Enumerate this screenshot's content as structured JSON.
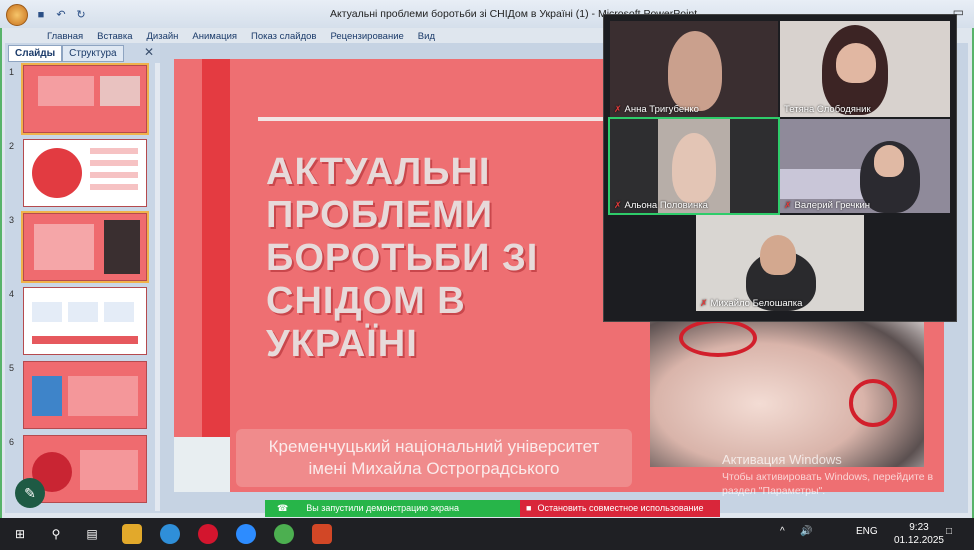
{
  "window": {
    "title": "Актуальні проблеми боротьби зі СНІДом в Україні (1) - Microsoft PowerPoint",
    "ribbon_tabs": [
      "Главная",
      "Вставка",
      "Дизайн",
      "Анимация",
      "Показ слайдов",
      "Рецензирование",
      "Вид"
    ]
  },
  "left_panel": {
    "tabs": [
      "Слайды",
      "Структура"
    ],
    "slide_numbers": [
      "1",
      "2",
      "3",
      "4",
      "5",
      "6"
    ]
  },
  "slide": {
    "title": "АКТУАЛЬНІ ПРОБЛЕМИ БОРОТЬБИ ЗІ СНІДОМ В УКРАЇНІ",
    "subtitle_line1": "Кременчуцький національний університет",
    "subtitle_line2": "імені Михайла Остроградського"
  },
  "windows_activation": {
    "line1": "Активация Windows",
    "line2": "Чтобы активировать Windows, перейдите в раздел \"Параметры\"."
  },
  "video_participants": [
    {
      "name": "Анна Тригубенко"
    },
    {
      "name": "Тетяна Слободяник"
    },
    {
      "name": "Альона Половинка"
    },
    {
      "name": "Валерий Гречкин"
    },
    {
      "name": "Михайло Белошапка"
    }
  ],
  "share": {
    "status": "Вы запустили демонстрацию экрана",
    "stop": "Остановить совместное использование"
  },
  "taskbar": {
    "language": "ENG",
    "time": "9:23",
    "date": "01.12.2025"
  }
}
